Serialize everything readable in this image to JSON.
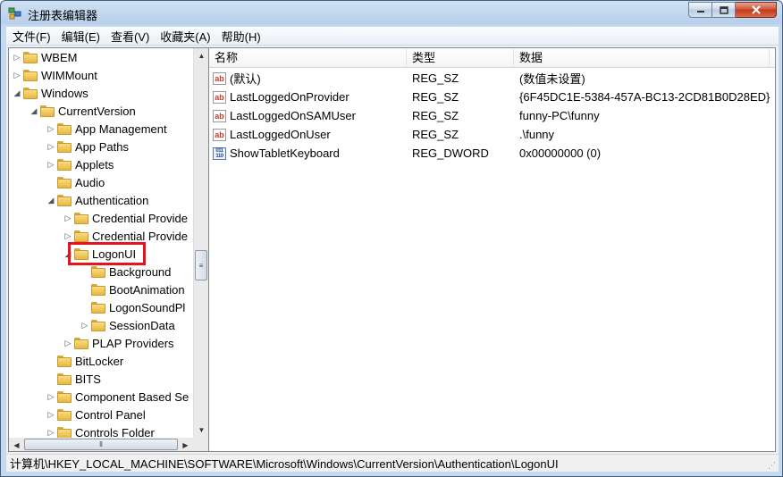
{
  "window": {
    "title": "注册表编辑器"
  },
  "menubar": [
    "文件(F)",
    "编辑(E)",
    "查看(V)",
    "收藏夹(A)",
    "帮助(H)"
  ],
  "tree": [
    {
      "label": "WBEM",
      "depth": 0,
      "arrow": "▷"
    },
    {
      "label": "WIMMount",
      "depth": 0,
      "arrow": "▷"
    },
    {
      "label": "Windows",
      "depth": 0,
      "arrow": "◢"
    },
    {
      "label": "CurrentVersion",
      "depth": 1,
      "arrow": "◢"
    },
    {
      "label": "App Management",
      "depth": 2,
      "arrow": "▷"
    },
    {
      "label": "App Paths",
      "depth": 2,
      "arrow": "▷"
    },
    {
      "label": "Applets",
      "depth": 2,
      "arrow": "▷"
    },
    {
      "label": "Audio",
      "depth": 2,
      "arrow": ""
    },
    {
      "label": "Authentication",
      "depth": 2,
      "arrow": "◢"
    },
    {
      "label": "Credential Provide",
      "depth": 3,
      "arrow": "▷"
    },
    {
      "label": "Credential Provide",
      "depth": 3,
      "arrow": "▷"
    },
    {
      "label": "LogonUI",
      "depth": 3,
      "arrow": "◢",
      "selected": true
    },
    {
      "label": "Background",
      "depth": 4,
      "arrow": ""
    },
    {
      "label": "BootAnimation",
      "depth": 4,
      "arrow": ""
    },
    {
      "label": "LogonSoundPl",
      "depth": 4,
      "arrow": ""
    },
    {
      "label": "SessionData",
      "depth": 4,
      "arrow": "▷"
    },
    {
      "label": "PLAP Providers",
      "depth": 3,
      "arrow": "▷"
    },
    {
      "label": "BitLocker",
      "depth": 2,
      "arrow": ""
    },
    {
      "label": "BITS",
      "depth": 2,
      "arrow": ""
    },
    {
      "label": "Component Based Se",
      "depth": 2,
      "arrow": "▷"
    },
    {
      "label": "Control Panel",
      "depth": 2,
      "arrow": "▷"
    },
    {
      "label": "Controls Folder",
      "depth": 2,
      "arrow": "▷"
    }
  ],
  "list": {
    "headers": {
      "name": "名称",
      "type": "类型",
      "data": "数据"
    },
    "rows": [
      {
        "icon": "string-value-icon",
        "name": "(默认)",
        "type": "REG_SZ",
        "data": "(数值未设置)"
      },
      {
        "icon": "string-value-icon",
        "name": "LastLoggedOnProvider",
        "type": "REG_SZ",
        "data": "{6F45DC1E-5384-457A-BC13-2CD81B0D28ED}"
      },
      {
        "icon": "string-value-icon",
        "name": "LastLoggedOnSAMUser",
        "type": "REG_SZ",
        "data": "funny-PC\\funny"
      },
      {
        "icon": "string-value-icon",
        "name": "LastLoggedOnUser",
        "type": "REG_SZ",
        "data": ".\\funny"
      },
      {
        "icon": "binary-value-icon",
        "name": "ShowTabletKeyboard",
        "type": "REG_DWORD",
        "data": "0x00000000 (0)"
      }
    ]
  },
  "statusbar": {
    "path": "计算机\\HKEY_LOCAL_MACHINE\\SOFTWARE\\Microsoft\\Windows\\CurrentVersion\\Authentication\\LogonUI"
  },
  "colors": {
    "highlight": "#e6121c",
    "folder": "#f2c95a"
  }
}
